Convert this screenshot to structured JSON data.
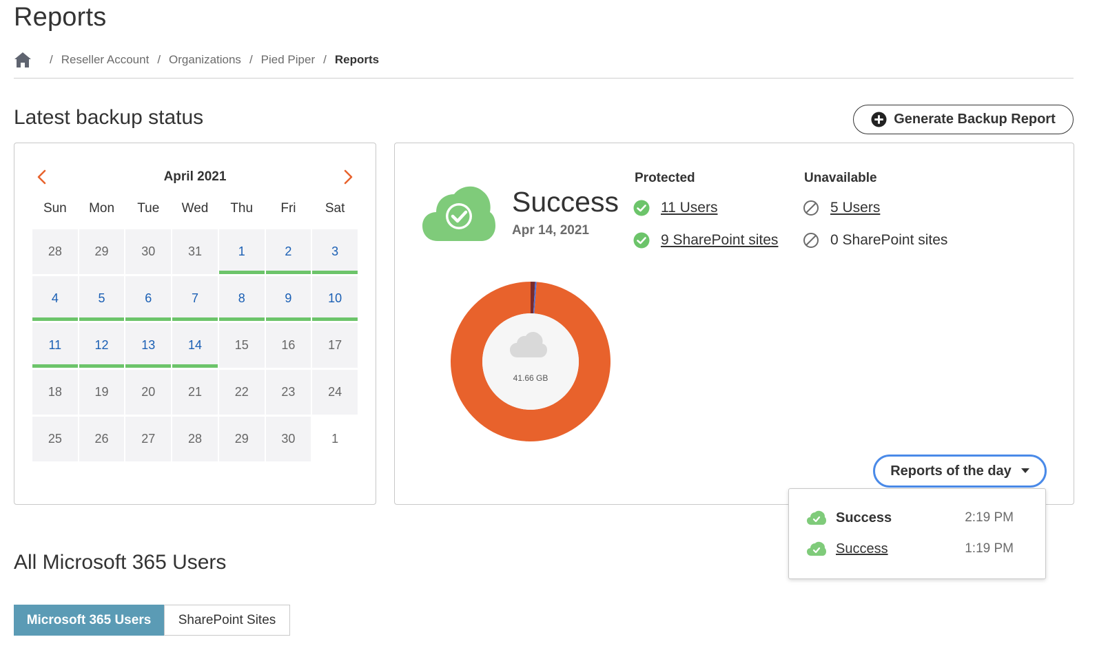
{
  "page": {
    "title": "Reports"
  },
  "breadcrumb": {
    "items": [
      "Reseller Account",
      "Organizations",
      "Pied Piper"
    ],
    "current": "Reports"
  },
  "backup": {
    "section_title": "Latest backup status",
    "generate_button": "Generate Backup Report"
  },
  "calendar": {
    "month_label": "April 2021",
    "weekdays": [
      "Sun",
      "Mon",
      "Tue",
      "Wed",
      "Thu",
      "Fri",
      "Sat"
    ],
    "days": [
      {
        "d": "28",
        "active": false
      },
      {
        "d": "29",
        "active": false
      },
      {
        "d": "30",
        "active": false
      },
      {
        "d": "31",
        "active": false
      },
      {
        "d": "1",
        "active": true
      },
      {
        "d": "2",
        "active": true
      },
      {
        "d": "3",
        "active": true
      },
      {
        "d": "4",
        "active": true
      },
      {
        "d": "5",
        "active": true
      },
      {
        "d": "6",
        "active": true
      },
      {
        "d": "7",
        "active": true
      },
      {
        "d": "8",
        "active": true
      },
      {
        "d": "9",
        "active": true
      },
      {
        "d": "10",
        "active": true
      },
      {
        "d": "11",
        "active": true
      },
      {
        "d": "12",
        "active": true
      },
      {
        "d": "13",
        "active": true
      },
      {
        "d": "14",
        "active": true
      },
      {
        "d": "15",
        "active": false
      },
      {
        "d": "16",
        "active": false
      },
      {
        "d": "17",
        "active": false
      },
      {
        "d": "18",
        "active": false
      },
      {
        "d": "19",
        "active": false
      },
      {
        "d": "20",
        "active": false
      },
      {
        "d": "21",
        "active": false
      },
      {
        "d": "22",
        "active": false
      },
      {
        "d": "23",
        "active": false
      },
      {
        "d": "24",
        "active": false
      },
      {
        "d": "25",
        "active": false
      },
      {
        "d": "26",
        "active": false
      },
      {
        "d": "27",
        "active": false
      },
      {
        "d": "28",
        "active": false
      },
      {
        "d": "29",
        "active": false
      },
      {
        "d": "30",
        "active": false
      },
      {
        "d": "1",
        "active": false,
        "blank": true
      }
    ]
  },
  "status": {
    "title": "Success",
    "date": "Apr 14, 2021",
    "protected_heading": "Protected",
    "unavailable_heading": "Unavailable",
    "protected_users": "11 Users",
    "protected_sites": "9 SharePoint sites",
    "unavailable_users": "5 Users",
    "unavailable_sites": "0 SharePoint sites"
  },
  "donut": {
    "center_label": "41.66 GB",
    "segments": [
      {
        "value": 0.988,
        "color": "#e8622c"
      },
      {
        "value": 0.009,
        "color": "#7a2a2a"
      },
      {
        "value": 0.003,
        "color": "#4a6fd8"
      }
    ]
  },
  "reports_of_day": {
    "button_label": "Reports of the day",
    "items": [
      {
        "label": "Success",
        "time": "2:19 PM"
      },
      {
        "label": "Success",
        "time": "1:19 PM"
      }
    ]
  },
  "users_section": {
    "title": "All Microsoft 365 Users",
    "tabs": [
      "Microsoft 365 Users",
      "SharePoint Sites"
    ]
  },
  "colors": {
    "accent_green": "#6cc46a",
    "accent_orange": "#e8622c",
    "link_blue": "#1a5fb4",
    "tab_blue": "#5b9bb5",
    "focus_blue": "#4a8ae8"
  }
}
